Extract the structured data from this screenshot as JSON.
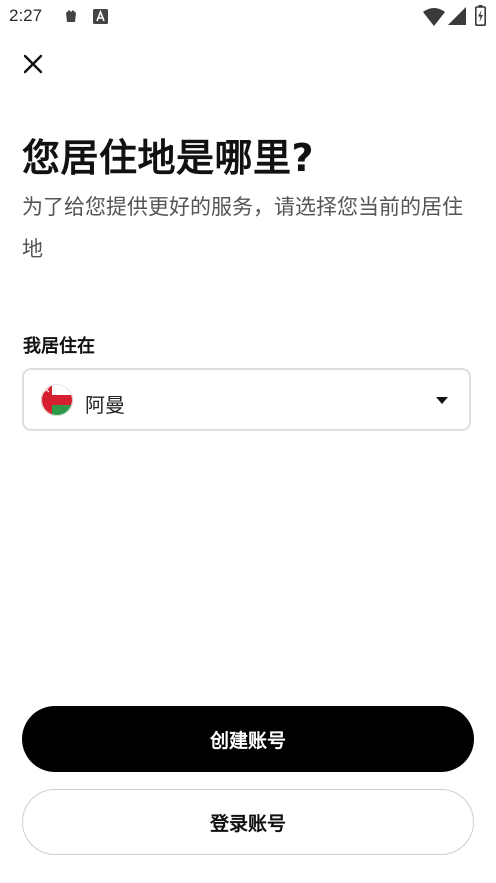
{
  "status_bar": {
    "time": "2:27",
    "icons": [
      "notification-icon",
      "accessibility-a-icon",
      "wifi-icon",
      "signal-icon",
      "battery-charging-icon"
    ]
  },
  "header": {
    "close_icon": "close-icon"
  },
  "main": {
    "title": "您居住地是哪里?",
    "subtitle": "为了给您提供更好的服务，请选择您当前的居住地",
    "field_label": "我居住在",
    "country": {
      "name": "阿曼",
      "flag_icon": "oman-flag-icon",
      "flag_colors": {
        "white": "#ffffff",
        "red": "#d7202f",
        "green": "#2e9a48"
      }
    }
  },
  "actions": {
    "create_account_label": "创建账号",
    "login_label": "登录账号"
  },
  "colors": {
    "primary_button_bg": "#000000",
    "primary_button_text": "#ffffff",
    "border": "#dedede",
    "subtitle_text": "#555555"
  }
}
